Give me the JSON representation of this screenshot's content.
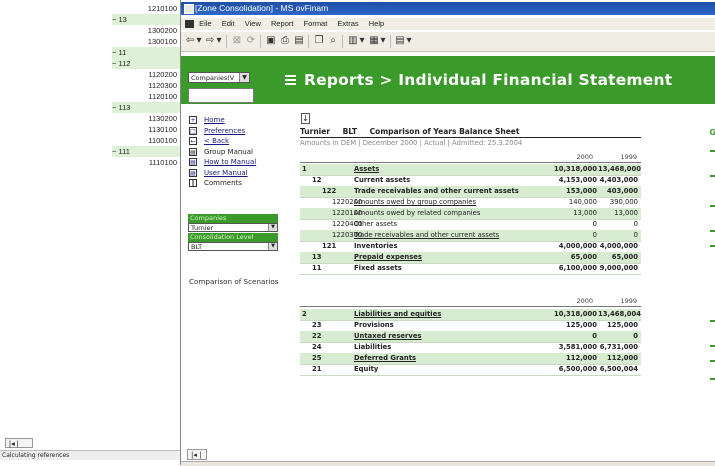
{
  "bg_app": {
    "tree": [
      {
        "text": "1210100",
        "kind": "leaf"
      },
      {
        "text": "13",
        "kind": "group"
      },
      {
        "text": "1300200",
        "kind": "leaf"
      },
      {
        "text": "1300100",
        "kind": "leaf"
      },
      {
        "text": "11",
        "kind": "group"
      },
      {
        "text": "112",
        "kind": "group"
      },
      {
        "text": "1120200",
        "kind": "leaf"
      },
      {
        "text": "1120300",
        "kind": "leaf"
      },
      {
        "text": "1120100",
        "kind": "leaf"
      },
      {
        "text": "113",
        "kind": "group"
      },
      {
        "text": "1130200",
        "kind": "leaf"
      },
      {
        "text": "1130100",
        "kind": "leaf"
      },
      {
        "text": "1100100",
        "kind": "leaf"
      },
      {
        "text": "111",
        "kind": "group"
      },
      {
        "text": "1110100",
        "kind": "leaf"
      }
    ],
    "status_text": "Calculating references"
  },
  "window": {
    "title": "[Zone Consolidation] - MS ovFinam",
    "menu": [
      "Eile",
      "Edit",
      "View",
      "Report",
      "Format",
      "Extras",
      "Help"
    ]
  },
  "banner": {
    "title": "Reports > Individual Financial Statement",
    "company_select": "Companies(V",
    "company_input": ""
  },
  "nav": {
    "items": [
      {
        "icon": "home-icon",
        "glyph": "+",
        "label": "Home",
        "link": true
      },
      {
        "icon": "preferences-icon",
        "glyph": "□",
        "label": "Preferences",
        "link": true
      },
      {
        "icon": "back-icon",
        "glyph": "←",
        "label": "< Back",
        "link": true
      },
      {
        "icon": "group-manual-icon",
        "glyph": "▤",
        "label": "Group Manual",
        "link": false
      },
      {
        "icon": "how-to-manual-icon",
        "glyph": "▤",
        "label": "How to Manual",
        "link": true
      },
      {
        "icon": "user-manual-icon",
        "glyph": "▤",
        "label": "User Manual",
        "link": true
      },
      {
        "icon": "comments-icon",
        "glyph": "‖",
        "label": "Comments",
        "link": false
      }
    ],
    "companies_label": "Companies",
    "companies_value": "Turnier",
    "level_label": "Consolidation Level",
    "level_value": "BLT",
    "comparison_label": "Comparison of Scenarios"
  },
  "report": {
    "header": [
      "Turnier",
      "BLT",
      "Comparison of Years Balance Sheet"
    ],
    "subtitle": "Amounts in DEM | December 2000 | Actual | Admitted: 25.3.2004",
    "years_a": [
      "2000",
      "1999"
    ],
    "rows_a": [
      {
        "code": "1",
        "indent": 0,
        "label": "Assets",
        "v1": "10,318,000",
        "v2": "13,468,000",
        "bold": true,
        "shade": true,
        "ul": true
      },
      {
        "code": "12",
        "indent": 1,
        "label": "Current assets",
        "v1": "4,153,000",
        "v2": "4,403,000",
        "bold": true,
        "shade": false,
        "ul": false
      },
      {
        "code": "122",
        "indent": 2,
        "label": "Trade receivables and other current assets",
        "v1": "153,000",
        "v2": "403,000",
        "bold": true,
        "shade": true,
        "ul": false
      },
      {
        "code": "1220200",
        "indent": 3,
        "label": "Amounts owed by group companies",
        "v1": "140,000",
        "v2": "390,000",
        "bold": false,
        "shade": false,
        "ul": true
      },
      {
        "code": "1220100",
        "indent": 3,
        "label": "Amounts owed by related companies",
        "v1": "13,000",
        "v2": "13,000",
        "bold": false,
        "shade": true,
        "ul": false
      },
      {
        "code": "1220400",
        "indent": 3,
        "label": "Other assets",
        "v1": "0",
        "v2": "0",
        "bold": false,
        "shade": false,
        "ul": false
      },
      {
        "code": "1220300",
        "indent": 3,
        "label": "Trade receivables and other current assets",
        "v1": "0",
        "v2": "0",
        "bold": false,
        "shade": true,
        "ul": true
      },
      {
        "code": "121",
        "indent": 2,
        "label": "Inventories",
        "v1": "4,000,000",
        "v2": "4,000,000",
        "bold": true,
        "shade": false,
        "ul": false
      },
      {
        "code": "13",
        "indent": 1,
        "label": "Prepaid expenses",
        "v1": "65,000",
        "v2": "65,000",
        "bold": true,
        "shade": true,
        "ul": true
      },
      {
        "code": "11",
        "indent": 1,
        "label": "Fixed assets",
        "v1": "6,100,000",
        "v2": "9,000,000",
        "bold": true,
        "shade": false,
        "ul": false
      }
    ],
    "years_b": [
      "2000",
      "1999"
    ],
    "rows_b": [
      {
        "code": "2",
        "indent": 0,
        "label": "Liabilities and equities",
        "v1": "10,318,000",
        "v2": "13,468,004",
        "bold": true,
        "shade": true,
        "ul": true
      },
      {
        "code": "23",
        "indent": 1,
        "label": "Provisions",
        "v1": "125,000",
        "v2": "125,000",
        "bold": true,
        "shade": false,
        "ul": false
      },
      {
        "code": "22",
        "indent": 1,
        "label": "Untaxed reserves",
        "v1": "0",
        "v2": "0",
        "bold": true,
        "shade": true,
        "ul": true
      },
      {
        "code": "24",
        "indent": 1,
        "label": "Liabilities",
        "v1": "3,581,000",
        "v2": "6,731,000",
        "bold": true,
        "shade": false,
        "ul": false
      },
      {
        "code": "25",
        "indent": 1,
        "label": "Deferred Grants",
        "v1": "112,000",
        "v2": "112,000",
        "bold": true,
        "shade": true,
        "ul": true
      },
      {
        "code": "21",
        "indent": 1,
        "label": "Equity",
        "v1": "6,500,000",
        "v2": "6,500,004",
        "bold": true,
        "shade": false,
        "ul": false
      }
    ]
  },
  "colors": {
    "accent": "#3a9a2a",
    "row_shade": "#d7ecd0",
    "titlebar": "#1f4fa5"
  }
}
